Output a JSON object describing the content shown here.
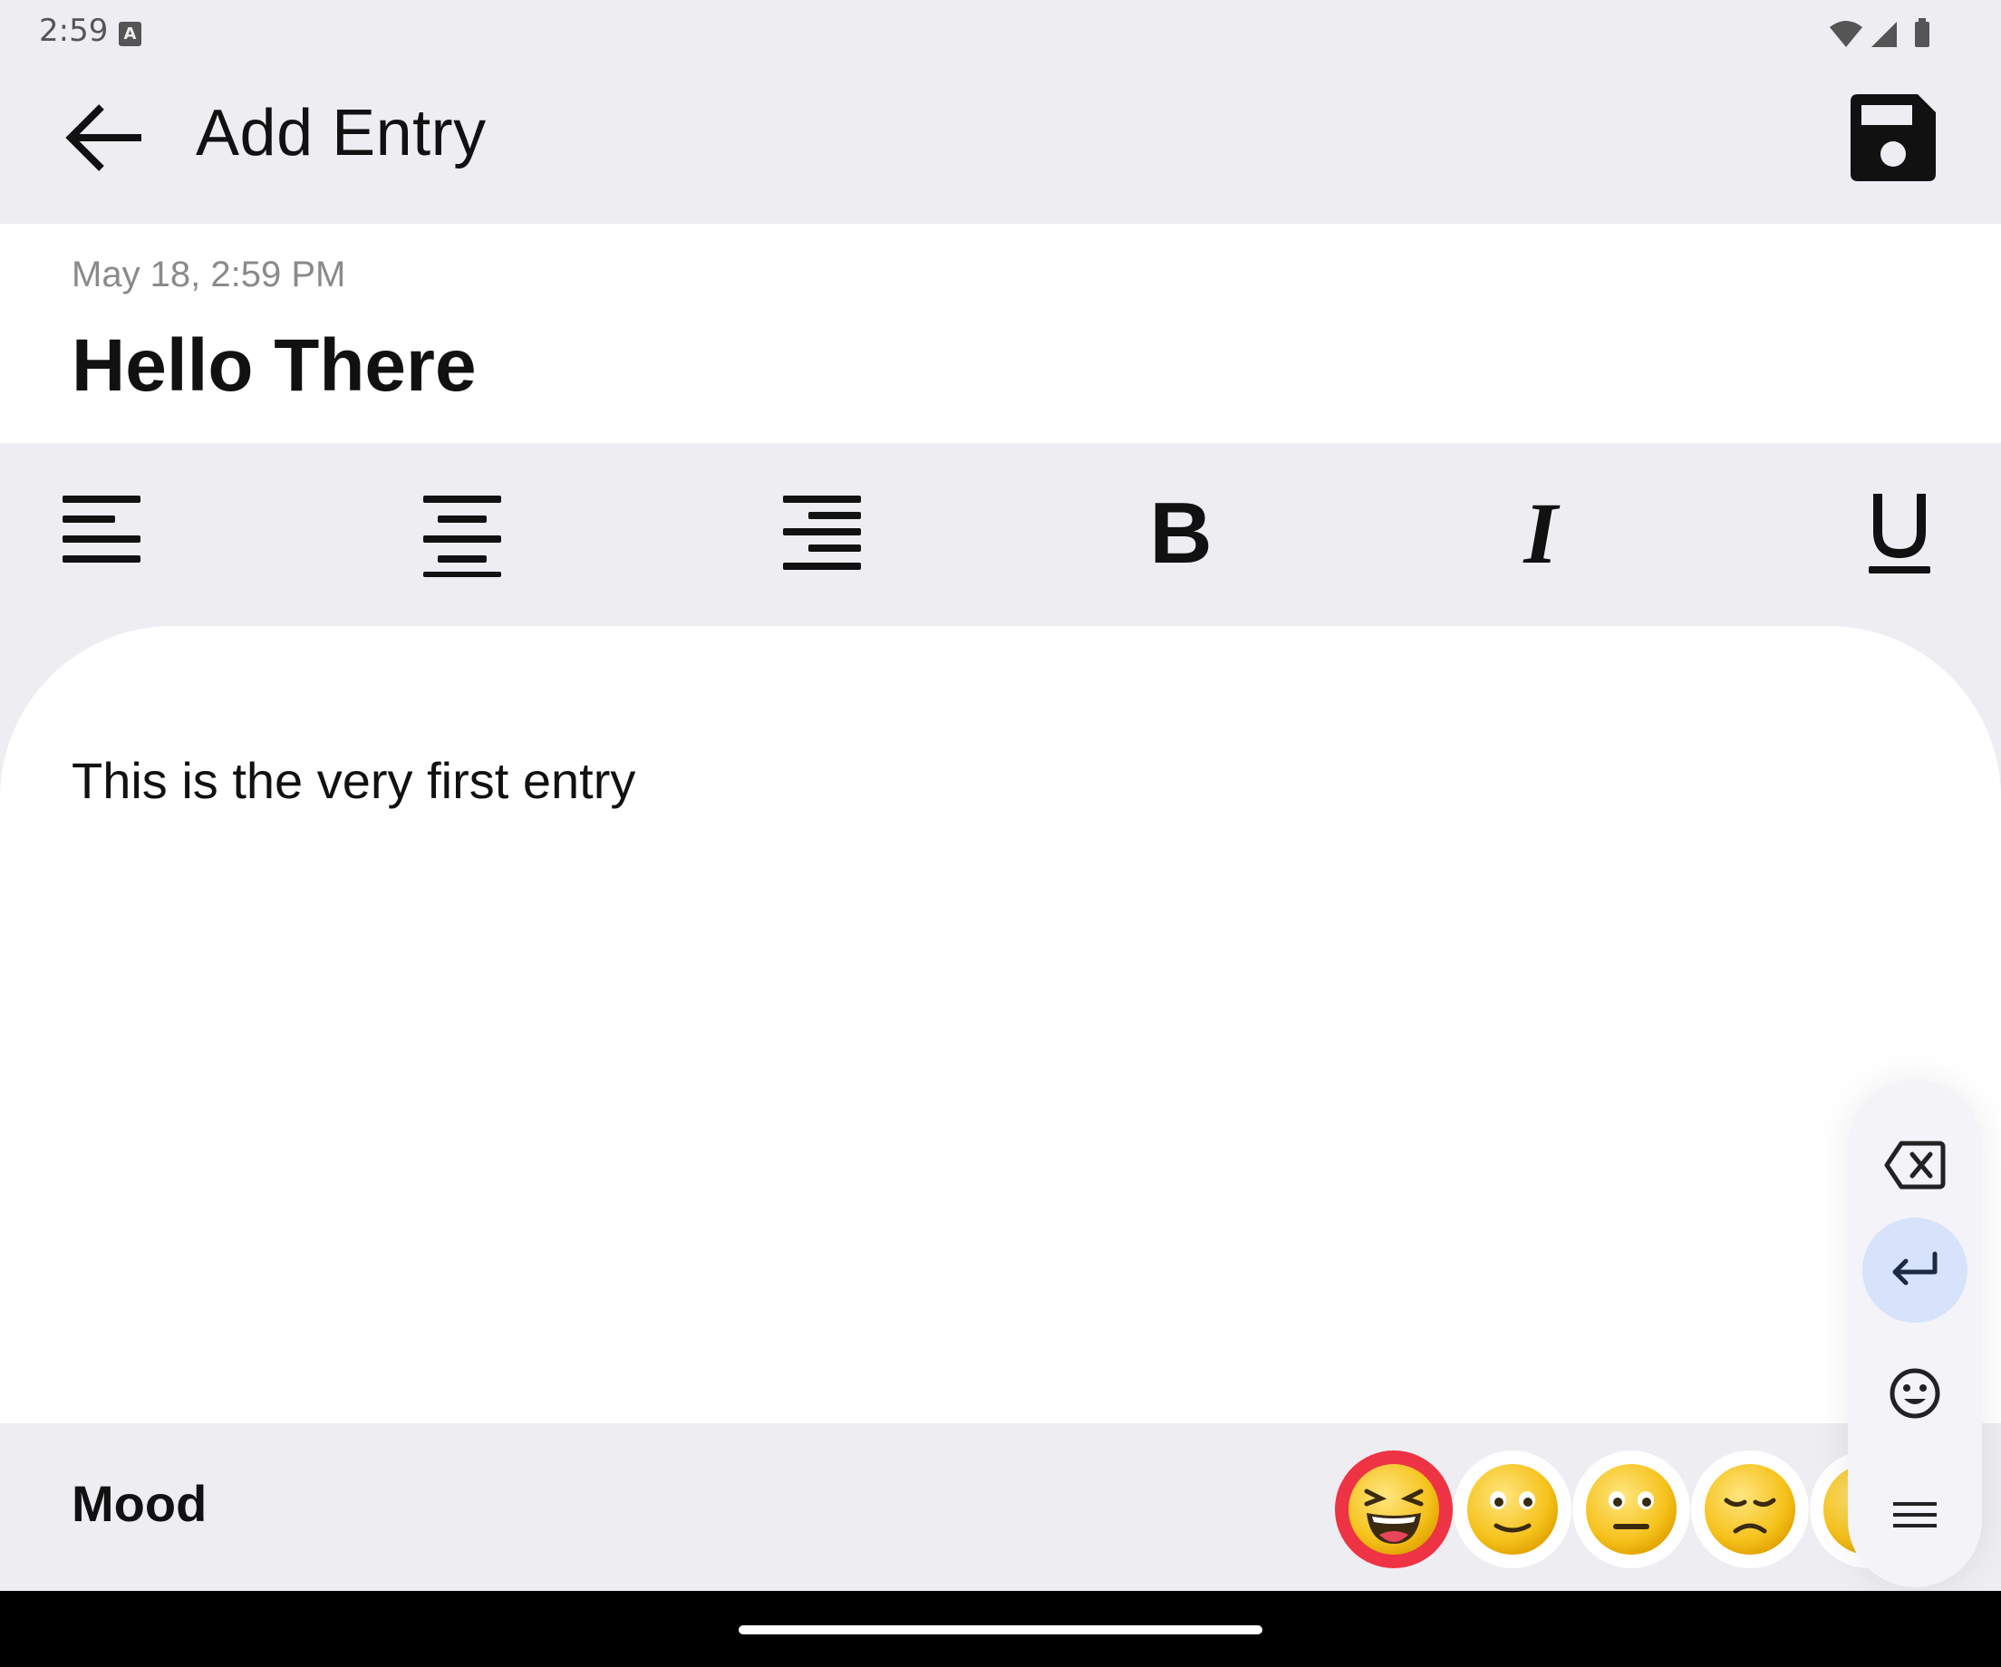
{
  "status_bar": {
    "time": "2:59",
    "keyboard_indicator": "A"
  },
  "app_bar": {
    "title": "Add Entry",
    "back_icon": "arrow-back-icon",
    "save_icon": "save-icon"
  },
  "entry": {
    "date": "May 18, 2:59 PM",
    "title": "Hello There",
    "body": "This is the very first entry"
  },
  "toolbar": {
    "tools": [
      {
        "name": "align-left",
        "icon": "align-left-icon"
      },
      {
        "name": "align-center",
        "icon": "align-center-icon"
      },
      {
        "name": "align-right",
        "icon": "align-right-icon"
      },
      {
        "name": "bold",
        "label": "B",
        "icon": "bold-icon"
      },
      {
        "name": "italic",
        "label": "I",
        "icon": "italic-icon"
      },
      {
        "name": "underline",
        "label": "U",
        "icon": "underline-icon"
      }
    ]
  },
  "mood": {
    "label": "Mood",
    "options": [
      {
        "name": "laughing",
        "selected": true
      },
      {
        "name": "smiling",
        "selected": false
      },
      {
        "name": "neutral",
        "selected": false
      },
      {
        "name": "sad",
        "selected": false
      },
      {
        "name": "more",
        "selected": false
      }
    ],
    "selected_color": "#ee3344"
  },
  "floating_keyboard": {
    "keys": [
      "backspace-icon",
      "enter-icon",
      "emoji-icon",
      "menu-icon"
    ],
    "active_key": "enter-icon",
    "active_color": "#d6e3fb"
  }
}
